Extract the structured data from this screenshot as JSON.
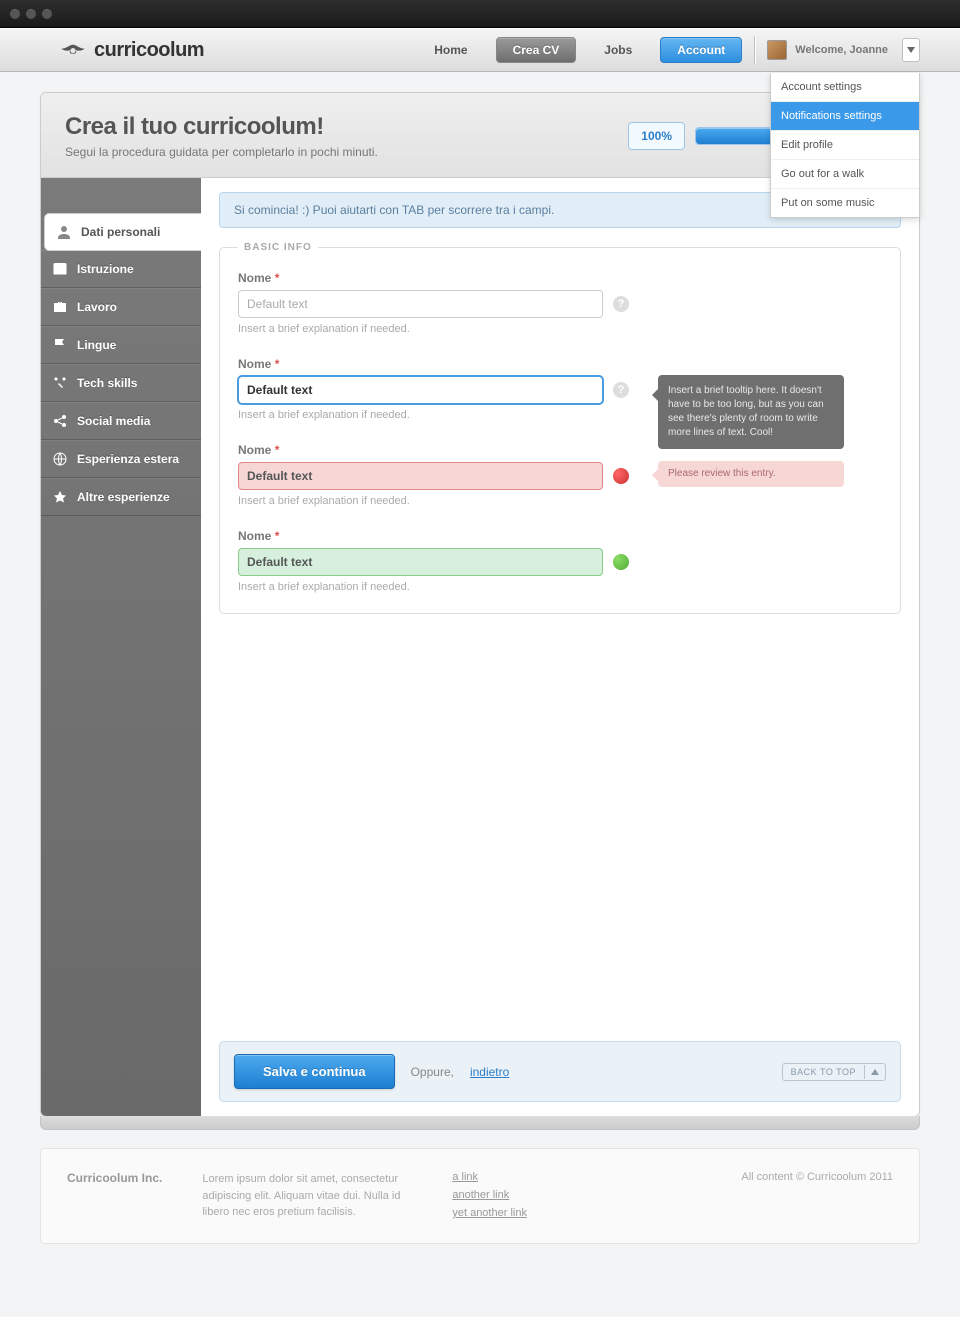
{
  "nav": {
    "brand": "curricoolum",
    "links": {
      "home": "Home",
      "crea": "Crea CV",
      "jobs": "Jobs",
      "account": "Account"
    },
    "welcome": "Welcome, Joanne"
  },
  "dropdown": {
    "items": [
      {
        "label": "Account settings",
        "active": false
      },
      {
        "label": "Notifications settings",
        "active": true
      },
      {
        "label": "Edit profile",
        "active": false
      },
      {
        "label": "Go out for a walk",
        "active": false
      },
      {
        "label": "Put on some music",
        "active": false
      }
    ]
  },
  "header": {
    "title": "Crea il tuo curricoolum!",
    "subtitle": "Segui la procedura guidata per completarlo in pochi minuti.",
    "progress_pct": "100%",
    "progress_value": 100
  },
  "sidebar": {
    "items": [
      {
        "label": "Dati personali",
        "icon": "person-icon",
        "active": true
      },
      {
        "label": "Istruzione",
        "icon": "book-icon",
        "active": false
      },
      {
        "label": "Lavoro",
        "icon": "briefcase-icon",
        "active": false
      },
      {
        "label": "Lingue",
        "icon": "flag-icon",
        "active": false
      },
      {
        "label": "Tech skills",
        "icon": "tools-icon",
        "active": false
      },
      {
        "label": "Social media",
        "icon": "share-icon",
        "active": false
      },
      {
        "label": "Esperienza estera",
        "icon": "globe-icon",
        "active": false
      },
      {
        "label": "Altre esperienze",
        "icon": "star-icon",
        "active": false
      }
    ]
  },
  "hint": "Si comincia! :) Puoi aiutarti con TAB per scorrere tra i campi.",
  "form": {
    "legend": "BASIC INFO",
    "fields": [
      {
        "label": "Nome",
        "required": "*",
        "placeholder": "Default text",
        "value": "",
        "help": "Insert a brief explanation if needed.",
        "state": "default"
      },
      {
        "label": "Nome",
        "required": "*",
        "placeholder": "",
        "value": "Default text",
        "help": "Insert a brief explanation if needed.",
        "state": "focused",
        "tooltip": "Insert a brief tooltip here. It doesn't have to be too long, but as you can see there's plenty of room to write more lines of text. Cool!"
      },
      {
        "label": "Nome",
        "required": "*",
        "placeholder": "",
        "value": "Default text",
        "help": "Insert a brief explanation if needed.",
        "state": "error",
        "error_msg": "Please review this entry."
      },
      {
        "label": "Nome",
        "required": "*",
        "placeholder": "",
        "value": "Default text",
        "help": "Insert a brief explanation if needed.",
        "state": "success"
      }
    ]
  },
  "footerbar": {
    "save": "Salva e continua",
    "or": "Oppure,",
    "back": "indietro",
    "backtop": "BACK TO TOP"
  },
  "sitefooter": {
    "company": "Curricoolum Inc.",
    "desc": "Lorem ipsum dolor sit amet, consectetur adipiscing elit. Aliquam vitae dui. Nulla id libero nec eros pretium facilisis.",
    "links": [
      "a link",
      "another link",
      "yet another link"
    ],
    "copyright": "All content © Curricoolum 2011"
  }
}
